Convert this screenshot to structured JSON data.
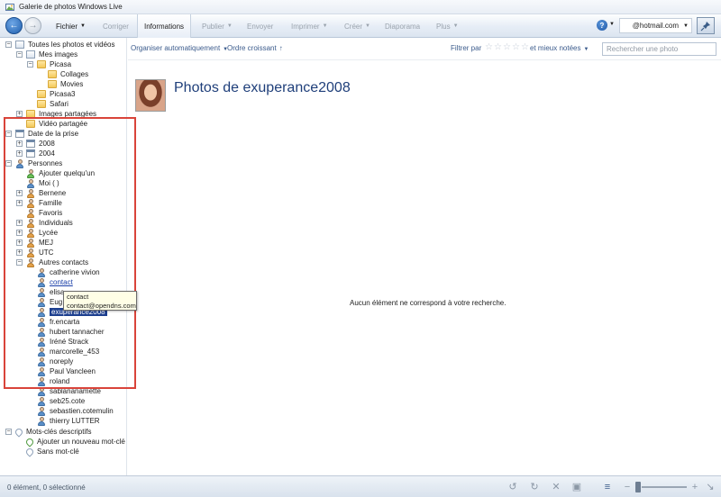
{
  "window": {
    "title": "Galerie de photos Windows Live"
  },
  "toolbar": {
    "menus": [
      {
        "label": "Fichier",
        "enabled": true,
        "dropdown": true
      },
      {
        "label": "Corriger",
        "enabled": false,
        "dropdown": false
      },
      {
        "label": "Informations",
        "enabled": true,
        "dropdown": false,
        "active": true
      },
      {
        "label": "Publier",
        "enabled": false,
        "dropdown": true
      },
      {
        "label": "Envoyer",
        "enabled": false,
        "dropdown": false
      },
      {
        "label": "Imprimer",
        "enabled": false,
        "dropdown": true
      },
      {
        "label": "Créer",
        "enabled": false,
        "dropdown": true
      },
      {
        "label": "Diaporama",
        "enabled": false,
        "dropdown": false
      },
      {
        "label": "Plus",
        "enabled": false,
        "dropdown": true
      }
    ],
    "account": "@hotmail.com"
  },
  "tree": {
    "all_photos": "Toutes les photos et vidéos",
    "my_images": "Mes images",
    "picasa": "Picasa",
    "collages": "Collages",
    "movies": "Movies",
    "picasa3": "Picasa3",
    "safari": "Safari",
    "shared_images": "Images partagées",
    "shared_video": "Vidéo partagée",
    "date_taken": "Date de la prise",
    "year_2008": "2008",
    "year_2004": "2004",
    "people": "Personnes",
    "add_someone": "Ajouter quelqu'un",
    "me": "Moi (        )",
    "groups": [
      "Bernene",
      "Famille",
      "Favoris",
      "Individuals",
      "Lycée",
      "MEJ",
      "UTC"
    ],
    "other_contacts": "Autres contacts",
    "contacts": [
      "catherine vivion",
      "contact",
      "elisa",
      "Eug",
      "exuperance2008",
      "fr.encarta",
      "hubert tannacher",
      "Iréné Strack",
      "marcorelle_453",
      "noreply",
      "Paul Vancleen",
      "roland",
      "sablananamette",
      "seb25.cote",
      "sebastien.cotemulin",
      "thierry LUTTER"
    ],
    "keywords": "Mots-clés descriptifs",
    "add_keyword": "Ajouter un nouveau mot-clé",
    "no_keyword": "Sans mot-clé"
  },
  "tooltip": {
    "line1": "contact",
    "line2": "contact@opendns.com"
  },
  "filterbar": {
    "organize": "Organiser automatiquement",
    "order": "Ordre croissant",
    "filter_by": "Filtrer par",
    "rating_suffix": "et mieux notées",
    "stars_selected": 0,
    "search_placeholder": "Rechercher une photo"
  },
  "main": {
    "title": "Photos de exuperance2008",
    "empty_message": "Aucun élément ne correspond à votre recherche."
  },
  "status": {
    "text": "0 élément, 0 sélectionné"
  },
  "colors": {
    "accent": "#1f3f7a",
    "selection": "#1d3f8f",
    "highlight_box": "#d9443a"
  }
}
